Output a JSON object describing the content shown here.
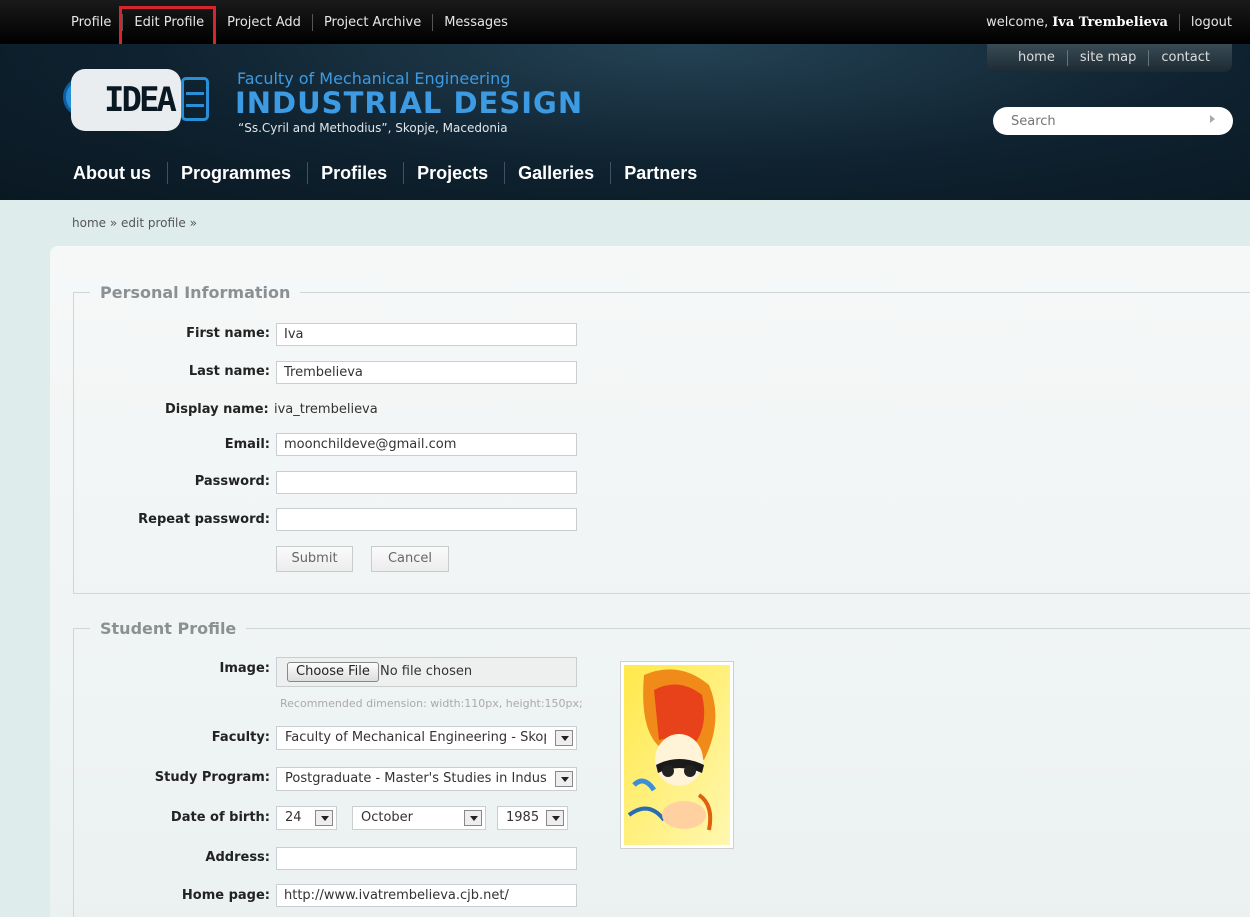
{
  "topbar": {
    "links": [
      "Profile",
      "Edit Profile",
      "Project Add",
      "Project Archive",
      "Messages"
    ],
    "welcome_text": "welcome,",
    "user_name": "Iva Trembelieva",
    "logout": "logout"
  },
  "utility_links": [
    "home",
    "site map",
    "contact"
  ],
  "branding": {
    "logo_text": "IDEA",
    "faculty": "Faculty of Mechanical Engineering",
    "department": "INDUSTRIAL DESIGN",
    "subtitle": "“Ss.Cyril and Methodius”, Skopje, Macedonia"
  },
  "search": {
    "placeholder": "Search"
  },
  "main_nav": [
    "About us",
    "Programmes",
    "Profiles",
    "Projects",
    "Galleries",
    "Partners"
  ],
  "breadcrumb": "home » edit profile »",
  "personal": {
    "legend": "Personal Information",
    "first_name_label": "First name:",
    "first_name": "Iva",
    "last_name_label": "Last name:",
    "last_name": "Trembelieva",
    "display_name_label": "Display name:",
    "display_name": "iva_trembelieva",
    "email_label": "Email:",
    "email": "moonchildeve@gmail.com",
    "password_label": "Password:",
    "repeat_password_label": "Repeat password:",
    "submit": "Submit",
    "cancel": "Cancel"
  },
  "student": {
    "legend": "Student Profile",
    "image_label": "Image:",
    "choose_file": "Choose File",
    "no_file": "No file chosen",
    "hint": "Recommended dimension: width:110px, height:150px;",
    "faculty_label": "Faculty:",
    "faculty": "Faculty of Mechanical Engineering - Skopje",
    "program_label": "Study Program:",
    "program": "Postgraduate - Master's Studies in Industrial Design",
    "dob_label": "Date of birth:",
    "dob_day": "24",
    "dob_month": "October",
    "dob_year": "1985",
    "address_label": "Address:",
    "address": "",
    "homepage_label": "Home page:",
    "homepage": "http://www.ivatrembelieva.cjb.net/"
  },
  "colors": {
    "accent_blue": "#3d9be4",
    "highlight_red": "#d4262c",
    "header_dark": "#0f2230"
  }
}
